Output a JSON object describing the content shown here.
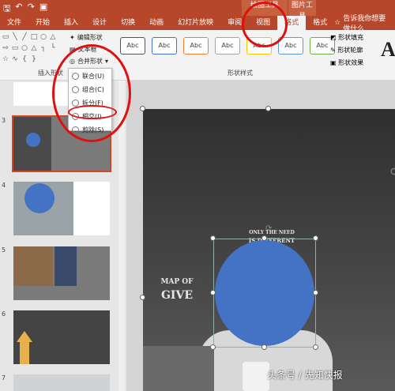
{
  "qat": {
    "save_icon": "save-icon",
    "undo_icon": "undo-icon",
    "redo_icon": "redo-icon",
    "present_icon": "present-icon"
  },
  "context_groups": {
    "drawing_tools": "绘图工具",
    "picture_tools": "图片工具"
  },
  "tabs": [
    {
      "label": "文件"
    },
    {
      "label": "开始"
    },
    {
      "label": "插入"
    },
    {
      "label": "设计"
    },
    {
      "label": "切换"
    },
    {
      "label": "动画"
    },
    {
      "label": "幻灯片放映"
    },
    {
      "label": "审阅"
    },
    {
      "label": "视图"
    },
    {
      "label": "格式",
      "active": true
    },
    {
      "label": "格式"
    }
  ],
  "tell_me": "告诉我你想要做什么",
  "ribbon": {
    "insert_shapes_label": "插入形状",
    "edit_shape": "编辑形状",
    "text_box": "文本框",
    "merge_shapes": "合并形状",
    "shape_styles_label": "形状样式",
    "style_samples": [
      "Abc",
      "Abc",
      "Abc",
      "Abc",
      "Abc",
      "Abc",
      "Abc"
    ],
    "shape_fill": "形状填充",
    "shape_outline": "形状轮廓",
    "shape_effects": "形状效果",
    "wordart_glyph": "A"
  },
  "merge_menu": [
    {
      "label": "联合(U)"
    },
    {
      "label": "组合(C)"
    },
    {
      "label": "拆分(F)"
    },
    {
      "label": "相交(I)"
    },
    {
      "label": "剪除(S)"
    }
  ],
  "slides": [
    {
      "number": "3"
    },
    {
      "number": "4"
    },
    {
      "number": "5"
    },
    {
      "number": "6"
    },
    {
      "number": "7"
    }
  ],
  "slide_text": {
    "only_the_need": "ONLY THE NEED",
    "is_different": "IS DIFFERENT",
    "map_of": "MAP OF",
    "give": "GIVE"
  },
  "watermark": "头条号 / 先知快报",
  "colors": {
    "accent": "#b7472a",
    "shape_blue": "#4472c4",
    "annotation_red": "#e01010"
  }
}
